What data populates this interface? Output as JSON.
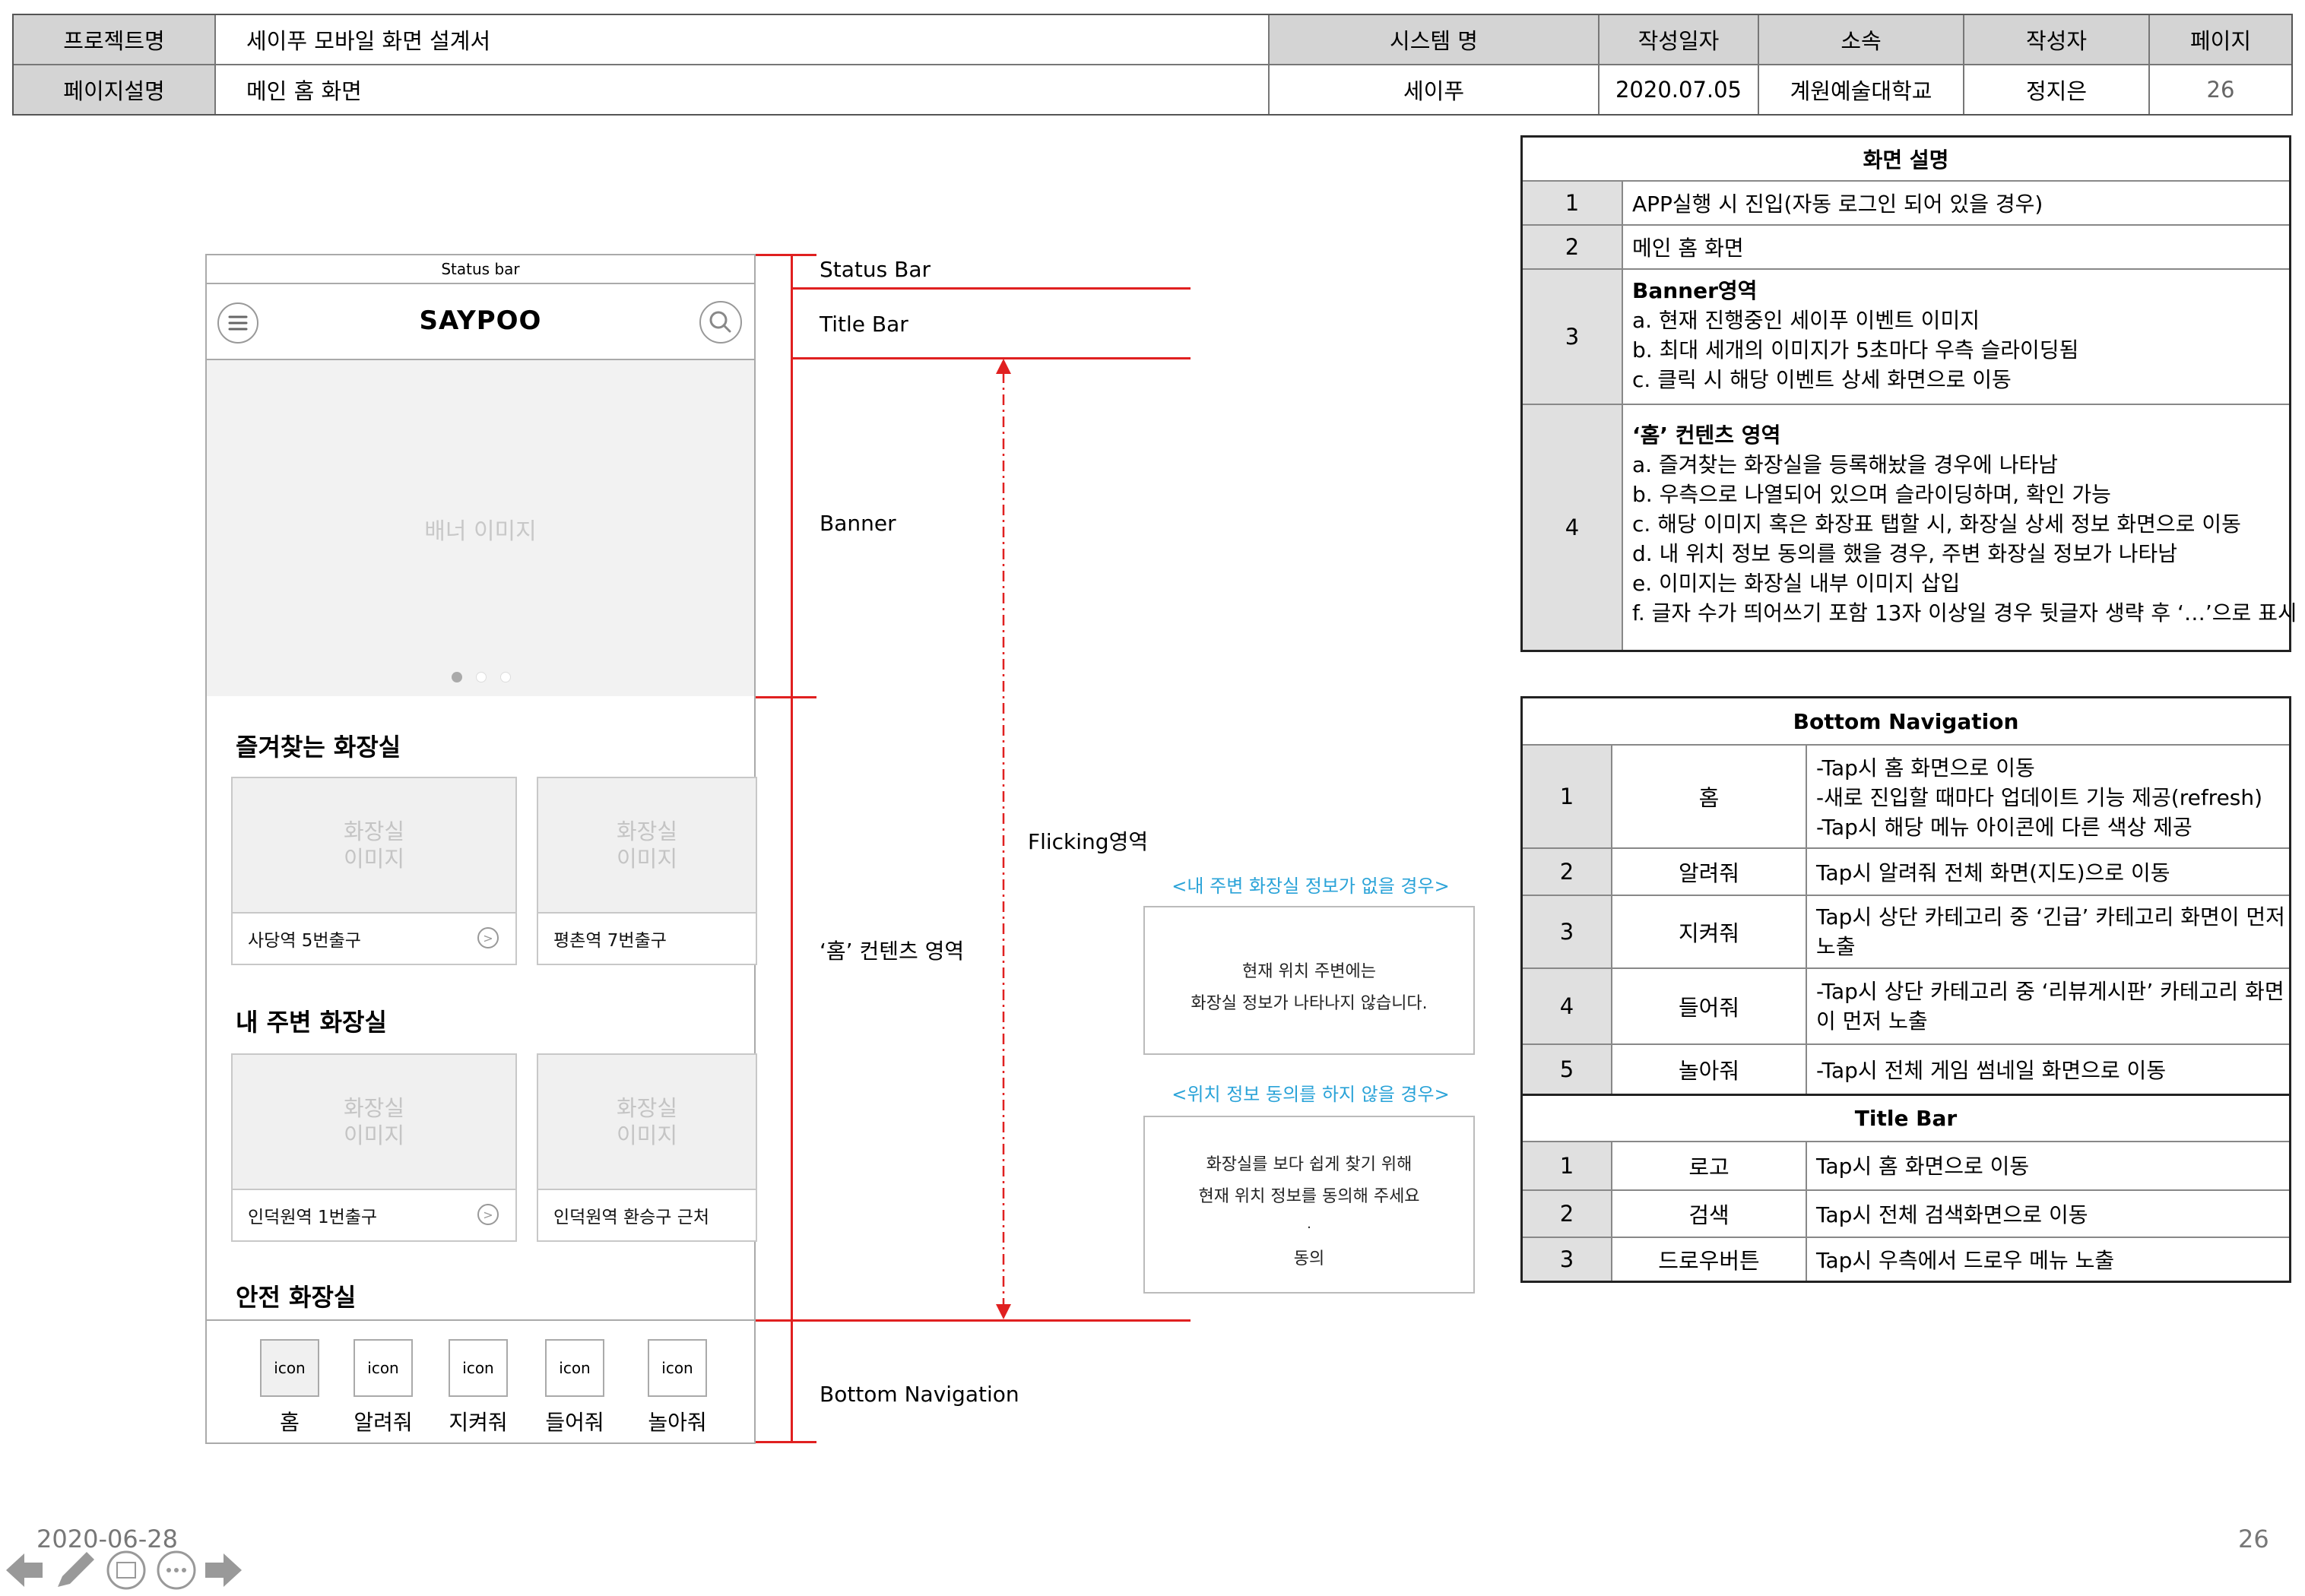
{
  "header": {
    "project_label": "프로젝트명",
    "project_value": "세이푸 모바일 화면 설계서",
    "system_label": "시스템 명",
    "system_value": "세이푸",
    "date_label": "작성일자",
    "date_value": "2020.07.05",
    "org_label": "소속",
    "org_value": "계원예술대학교",
    "author_label": "작성자",
    "author_value": "정지은",
    "page_label": "페이지",
    "page_value": "26",
    "desc_label": "페이지설명",
    "desc_value": "메인 홈 화면"
  },
  "phone": {
    "status_bar": "Status bar",
    "logo": "SAYPOO",
    "banner_text": "배너 이미지",
    "favorites_title": "즐겨찾는 화장실",
    "nearby_title": "내 주변 화장실",
    "safe_title": "안전 화장실",
    "card_image_text": "화장실\n이미지",
    "fav_cards": [
      {
        "caption": "사당역 5번출구"
      },
      {
        "caption": "평촌역 7번출구"
      }
    ],
    "near_cards": [
      {
        "caption": "인덕원역 1번출구"
      },
      {
        "caption": "인덕원역 환승구 근처"
      }
    ],
    "nav": [
      {
        "icon": "icon",
        "label": "홈"
      },
      {
        "icon": "icon",
        "label": "알려줘"
      },
      {
        "icon": "icon",
        "label": "지켜줘"
      },
      {
        "icon": "icon",
        "label": "들어줘"
      },
      {
        "icon": "icon",
        "label": "놀아줘"
      }
    ]
  },
  "annotations": {
    "status_bar": "Status Bar",
    "title_bar": "Title Bar",
    "banner": "Banner",
    "home_contents": "‘홈’ 컨텐츠 영역",
    "flicking": "Flicking영역",
    "bottom_nav": "Bottom Navigation"
  },
  "popups": {
    "no_info_caption": "<내 주변 화장실 정보가 없을 경우>",
    "no_info_line1": "현재 위치 주변에는",
    "no_info_line2": "화장실 정보가 나타나지 않습니다.",
    "no_consent_caption": "<위치 정보 동의를 하지 않을 경우>",
    "no_consent_line1": "화장실를 보다 쉽게 찾기 위해",
    "no_consent_line2": "현재 위치 정보를 동의해 주세요",
    "no_consent_dot": ".",
    "no_consent_button": "동의"
  },
  "screen_desc": {
    "title": "화면 설명",
    "rows": [
      {
        "num": "1",
        "lines": [
          "APP실행 시 진입(자동 로그인 되어 있을 경우)"
        ]
      },
      {
        "num": "2",
        "lines": [
          "메인 홈 화면"
        ]
      },
      {
        "num": "3",
        "heading": "Banner영역",
        "lines": [
          "a. 현재 진행중인 세이푸 이벤트 이미지",
          "b. 최대 세개의 이미지가 5초마다 우측 슬라이딩됨",
          "c. 클릭 시 해당 이벤트 상세 화면으로 이동"
        ]
      },
      {
        "num": "4",
        "heading": "‘홈’ 컨텐츠 영역",
        "lines": [
          "a. 즐겨찾는 화장실을 등록해놨을 경우에 나타남",
          "b. 우측으로 나열되어 있으며 슬라이딩하며, 확인 가능",
          "c. 해당 이미지 혹은 화장표 탭할 시, 화장실 상세 정보 화면으로 이동",
          "d. 내 위치 정보 동의를 했을 경우, 주변 화장실 정보가 나타남",
          "e. 이미지는 화장실 내부 이미지 삽입",
          "f. 글자 수가 띄어쓰기 포함 13자 이상일 경우 뒷글자 생략 후 ‘…’으로 표시"
        ]
      }
    ]
  },
  "bottom_nav_table": {
    "title": "Bottom Navigation",
    "rows": [
      {
        "num": "1",
        "name": "홈",
        "lines": [
          "-Tap시 홈 화면으로 이동",
          "-새로 진입할 때마다 업데이트 기능 제공(refresh)",
          "-Tap시 해당 메뉴 아이콘에 다른 색상 제공"
        ]
      },
      {
        "num": "2",
        "name": "알려줘",
        "lines": [
          "Tap시 알려줘 전체 화면(지도)으로 이동"
        ]
      },
      {
        "num": "3",
        "name": "지켜줘",
        "lines": [
          "Tap시 상단 카테고리 중 ‘긴급’ 카테고리 화면이 먼저",
          "노출"
        ]
      },
      {
        "num": "4",
        "name": "들어줘",
        "lines": [
          "-Tap시 상단 카테고리 중 ‘리뷰게시판’ 카테고리 화면",
          "이 먼저 노출"
        ]
      },
      {
        "num": "5",
        "name": "놀아줘",
        "lines": [
          "-Tap시 전체 게임 썸네일 화면으로 이동"
        ]
      }
    ]
  },
  "title_bar_table": {
    "title": "Title Bar",
    "rows": [
      {
        "num": "1",
        "name": "로고",
        "lines": [
          "Tap시 홈 화면으로 이동"
        ]
      },
      {
        "num": "2",
        "name": "검색",
        "lines": [
          "Tap시 전체 검색화면으로 이동"
        ]
      },
      {
        "num": "3",
        "name": "드로우버튼",
        "lines": [
          "Tap시 우측에서 드로우 메뉴 노출"
        ]
      }
    ]
  },
  "footer": {
    "date": "2020-06-28",
    "page": "26"
  }
}
